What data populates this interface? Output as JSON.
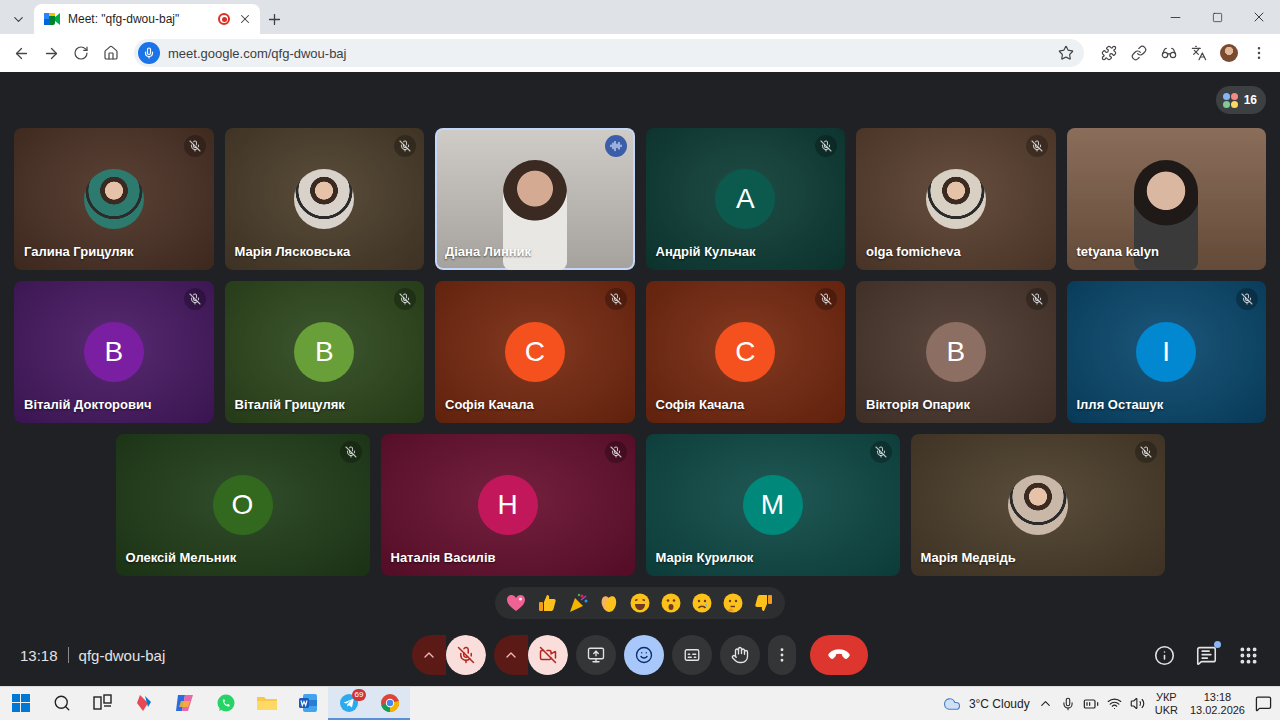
{
  "browser": {
    "tab_title": "Meet: \"qfg-dwou-baj\"",
    "recording": true,
    "url": "meet.google.com/qfg-dwou-baj"
  },
  "meeting": {
    "participant_count": "16",
    "participants": [
      {
        "name": "Галина Грицуляк",
        "kind": "photo",
        "color": "#4e3326",
        "avatar_color": "#2d7a6e",
        "muted": true,
        "speaking": false
      },
      {
        "name": "Марія Лясковська",
        "kind": "photo",
        "color": "#4d3f2c",
        "avatar_color": "#d9d2ca",
        "muted": true,
        "speaking": false
      },
      {
        "name": "Діана Линник",
        "kind": "video",
        "color": "#c9c5c0",
        "muted": false,
        "speaking": true
      },
      {
        "name": "Андрій Кульчак",
        "kind": "letter",
        "initial": "А",
        "color": "#0f3f38",
        "avatar_color": "#0b5a4d",
        "muted": true,
        "speaking": false
      },
      {
        "name": "olga fomicheva",
        "kind": "photo",
        "color": "#5b4130",
        "avatar_color": "#d8d0c2",
        "muted": true,
        "speaking": false
      },
      {
        "name": "tetyana kalyn",
        "kind": "video",
        "color": "#7a5a44",
        "muted": false,
        "speaking": false
      },
      {
        "name": "Віталій Докторович",
        "kind": "letter",
        "initial": "В",
        "color": "#4a1a66",
        "avatar_color": "#7b1fa2",
        "muted": true,
        "speaking": false
      },
      {
        "name": "Віталій Грицуляк",
        "kind": "letter",
        "initial": "В",
        "color": "#2f4a1e",
        "avatar_color": "#689f38",
        "muted": true,
        "speaking": false
      },
      {
        "name": "Софія Качала",
        "kind": "letter",
        "initial": "С",
        "color": "#7a2a10",
        "avatar_color": "#f4511e",
        "muted": true,
        "speaking": false
      },
      {
        "name": "Софія Качала",
        "kind": "letter",
        "initial": "С",
        "color": "#7a2a10",
        "avatar_color": "#f4511e",
        "muted": true,
        "speaking": false
      },
      {
        "name": "Вікторія Опарик",
        "kind": "letter",
        "initial": "В",
        "color": "#4e3a30",
        "avatar_color": "#8d6e63",
        "muted": true,
        "speaking": false
      },
      {
        "name": "Ілля Осташук",
        "kind": "letter",
        "initial": "І",
        "color": "#0a4a70",
        "avatar_color": "#0288d1",
        "muted": true,
        "speaking": false
      },
      {
        "name": "Олексій Мельник",
        "kind": "letter",
        "initial": "О",
        "color": "#22401a",
        "avatar_color": "#33691e",
        "muted": true,
        "speaking": false
      },
      {
        "name": "Наталія Василів",
        "kind": "letter",
        "initial": "Н",
        "color": "#6a1030",
        "avatar_color": "#c2185b",
        "muted": true,
        "speaking": false
      },
      {
        "name": "Марія Курилюк",
        "kind": "letter",
        "initial": "М",
        "color": "#0f4c48",
        "avatar_color": "#00897b",
        "muted": true,
        "speaking": false
      },
      {
        "name": "Марія Медвідь",
        "kind": "photo",
        "color": "#4d3f2c",
        "avatar_color": "#c9b8a8",
        "muted": true,
        "speaking": false
      }
    ],
    "time": "13:18",
    "code": "qfg-dwou-baj",
    "controls": {
      "microphone_on": false,
      "camera_on": false,
      "reactions_open": true,
      "chat_unread": true
    }
  },
  "taskbar": {
    "weather": "3°C Cloudy",
    "language": "УКР",
    "layout": "UKR",
    "time": "13:18",
    "date": "13.02.2026",
    "telegram_badge": "69"
  }
}
